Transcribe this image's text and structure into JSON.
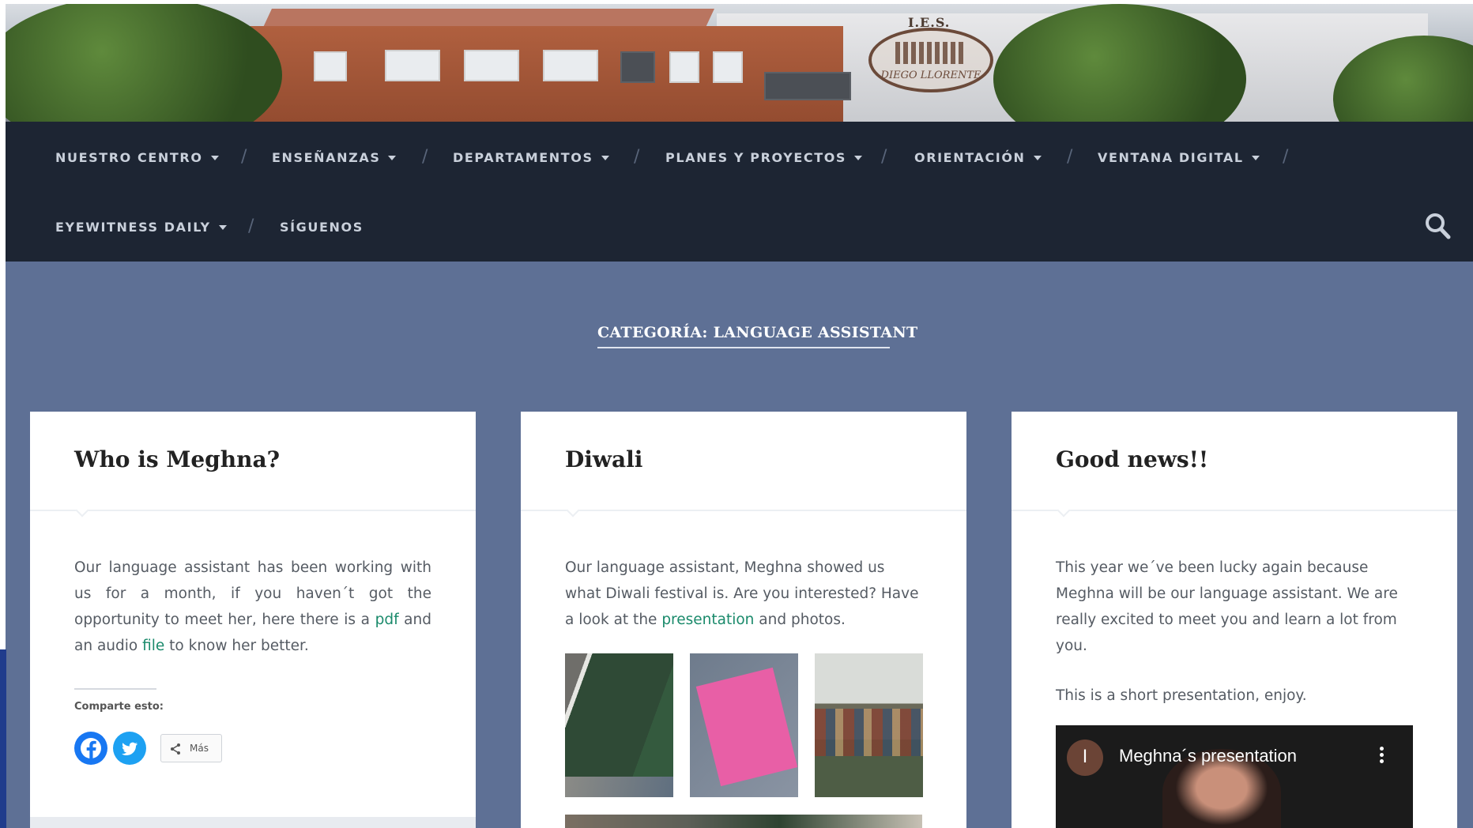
{
  "header": {
    "logo_top_text": "I.E.S.",
    "logo_name_text": "DIEGO LLORENTE"
  },
  "nav": {
    "items": [
      {
        "label": "NUESTRO CENTRO",
        "has_dropdown": true
      },
      {
        "label": "ENSEÑANZAS",
        "has_dropdown": true
      },
      {
        "label": "DEPARTAMENTOS",
        "has_dropdown": true
      },
      {
        "label": "PLANES Y PROYECTOS",
        "has_dropdown": true
      },
      {
        "label": "ORIENTACIÓN",
        "has_dropdown": true
      },
      {
        "label": "VENTANA DIGITAL",
        "has_dropdown": true
      },
      {
        "label": "EYEWITNESS DAILY",
        "has_dropdown": true
      },
      {
        "label": "SÍGUENOS",
        "has_dropdown": false
      }
    ],
    "separator": "/",
    "search_icon": "search-icon"
  },
  "category": {
    "title": "CATEGORÍA: LANGUAGE ASSISTANT"
  },
  "posts": [
    {
      "title": "Who is Meghna?",
      "body_1": "Our language assistant has been working with us for a month, if you haven´t got the opportunity to meet her, here there is a ",
      "link_1": "pdf",
      "body_2": " and an audio ",
      "link_2": "file",
      "body_3": " to know her better.",
      "share": {
        "label": "Comparte esto:",
        "facebook_icon": "facebook-icon",
        "twitter_icon": "twitter-icon",
        "more_label": "Más"
      }
    },
    {
      "title": "Diwali",
      "body_1": "Our language assistant, Meghna showed us what Diwali festival is. Are you interested? Have a look at the ",
      "link_1": "presentation",
      "body_2": " and photos."
    },
    {
      "title": "Good news!!",
      "para_1": "This year we´ve been lucky again because Meghna will be our language assistant. We are really excited to meet you and learn a lot from you.",
      "para_2": "This is a short presentation, enjoy.",
      "video": {
        "avatar_letter": "I",
        "title": "Meghna´s presentation"
      }
    }
  ],
  "colors": {
    "nav_bg": "#1d2533",
    "page_bg": "#5e7095",
    "link": "#1a8a6b",
    "facebook": "#1877f2",
    "twitter": "#1da1f2"
  }
}
